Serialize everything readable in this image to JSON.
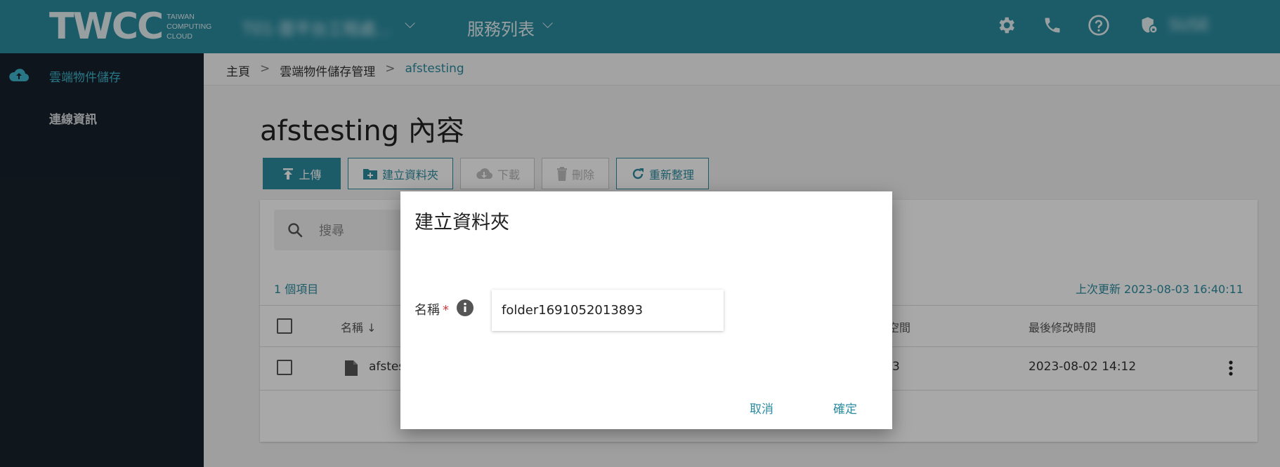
{
  "header": {
    "logo_mark": "TWCC",
    "logo_sub": [
      "TAIWAN",
      "COMPUTING",
      "CLOUD"
    ],
    "project_label": "T01-雲平台工程處...",
    "services_label": "服務列表",
    "user_name": "SUSE",
    "icons": [
      "gear-icon",
      "phone-icon",
      "help-icon",
      "user-shield-icon"
    ]
  },
  "sidebar": {
    "items": [
      {
        "label": "雲端物件儲存",
        "icon": "cloud-upload-icon",
        "active": true
      },
      {
        "label": "連線資訊",
        "active": false
      }
    ]
  },
  "breadcrumb": {
    "home": "主頁",
    "section": "雲端物件儲存管理",
    "current": "afstesting",
    "separator": ">"
  },
  "page": {
    "title": "afstesting 內容"
  },
  "toolbar": {
    "upload": "上傳",
    "create_folder": "建立資料夾",
    "download": "下載",
    "delete": "刪除",
    "refresh": "重新整理"
  },
  "table": {
    "search_placeholder": "搜尋",
    "item_count": "1 個項目",
    "last_updated": "上次更新 2023-08-03 16:40:11",
    "columns": {
      "name": "名稱 ↓",
      "size": "空間",
      "modified": "最後修改時間"
    },
    "rows": [
      {
        "name": "afstes",
        "size": "3",
        "modified": "2023-08-02 14:12"
      }
    ]
  },
  "dialog": {
    "title": "建立資料夾",
    "name_label": "名稱",
    "required_mark": "*",
    "name_value": "folder1691052013893",
    "cancel_label": "取消",
    "confirm_label": "確定"
  },
  "colors": {
    "accent": "#2b8ca0",
    "sidebar_bg": "#17212b",
    "required": "#d03b3b"
  }
}
